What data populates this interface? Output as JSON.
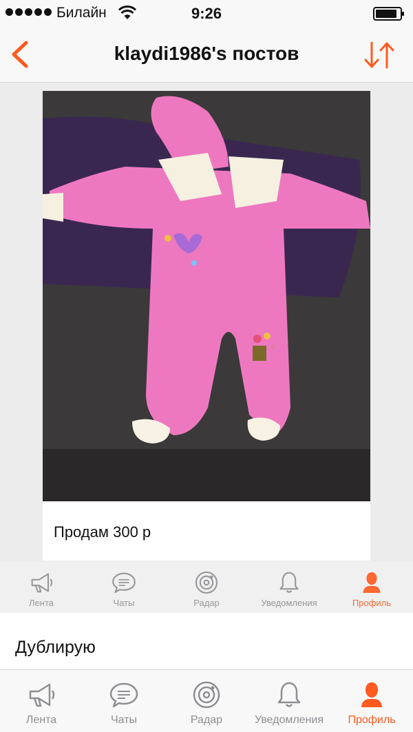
{
  "status_bar": {
    "carrier": "Билайн",
    "time": "9:26"
  },
  "nav": {
    "title": "klaydi1986's постов",
    "accent_color": "#ff5a1f",
    "back_icon": "chevron-left-icon",
    "sort_icon": "sort-arrows-icon"
  },
  "post": {
    "caption": "Продам 300 р",
    "image_description_icon": "photo"
  },
  "overlay_tabs": [
    {
      "label": "Лента",
      "icon": "megaphone-icon",
      "active": false
    },
    {
      "label": "Чаты",
      "icon": "chat-bubble-icon",
      "active": false
    },
    {
      "label": "Радар",
      "icon": "radar-icon",
      "active": false
    },
    {
      "label": "Уведомления",
      "icon": "bell-icon",
      "active": false
    },
    {
      "label": "Профиль",
      "icon": "profile-icon",
      "active": true
    }
  ],
  "below_text": "Дублирую",
  "tabs": [
    {
      "label": "Лента",
      "icon": "megaphone-icon",
      "active": false
    },
    {
      "label": "Чаты",
      "icon": "chat-bubble-icon",
      "active": false
    },
    {
      "label": "Радар",
      "icon": "radar-icon",
      "active": false
    },
    {
      "label": "Уведомления",
      "icon": "bell-icon",
      "active": false
    },
    {
      "label": "Профиль",
      "icon": "profile-icon",
      "active": true
    }
  ]
}
